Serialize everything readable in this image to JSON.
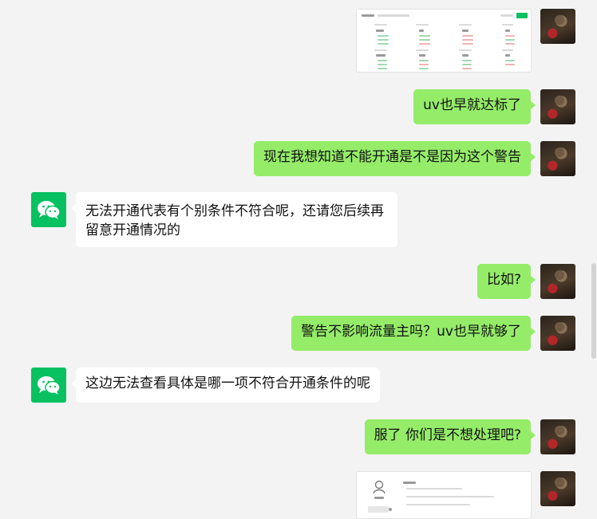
{
  "messages": [
    {
      "text": "uv也早就达标了"
    },
    {
      "text": "现在我想知道不能开通是不是因为这个警告"
    },
    {
      "text": "无法开通代表有个别条件不符合呢，还请您后续再留意开通情况的"
    },
    {
      "text": "比如?"
    },
    {
      "text": "警告不影响流量主吗？uv也早就够了"
    },
    {
      "text": "这边无法查看具体是哪一项不符合开通条件的呢"
    },
    {
      "text": "服了 你们是不想处理吧?"
    }
  ],
  "icons": {
    "bot_avatar": "wechat-icon",
    "user_avatar": "user-photo-avatar"
  },
  "colors": {
    "background": "#f3f3f3",
    "my_bubble": "#95ec69",
    "bot_bubble": "#ffffff",
    "wechat_green": "#07c160"
  }
}
